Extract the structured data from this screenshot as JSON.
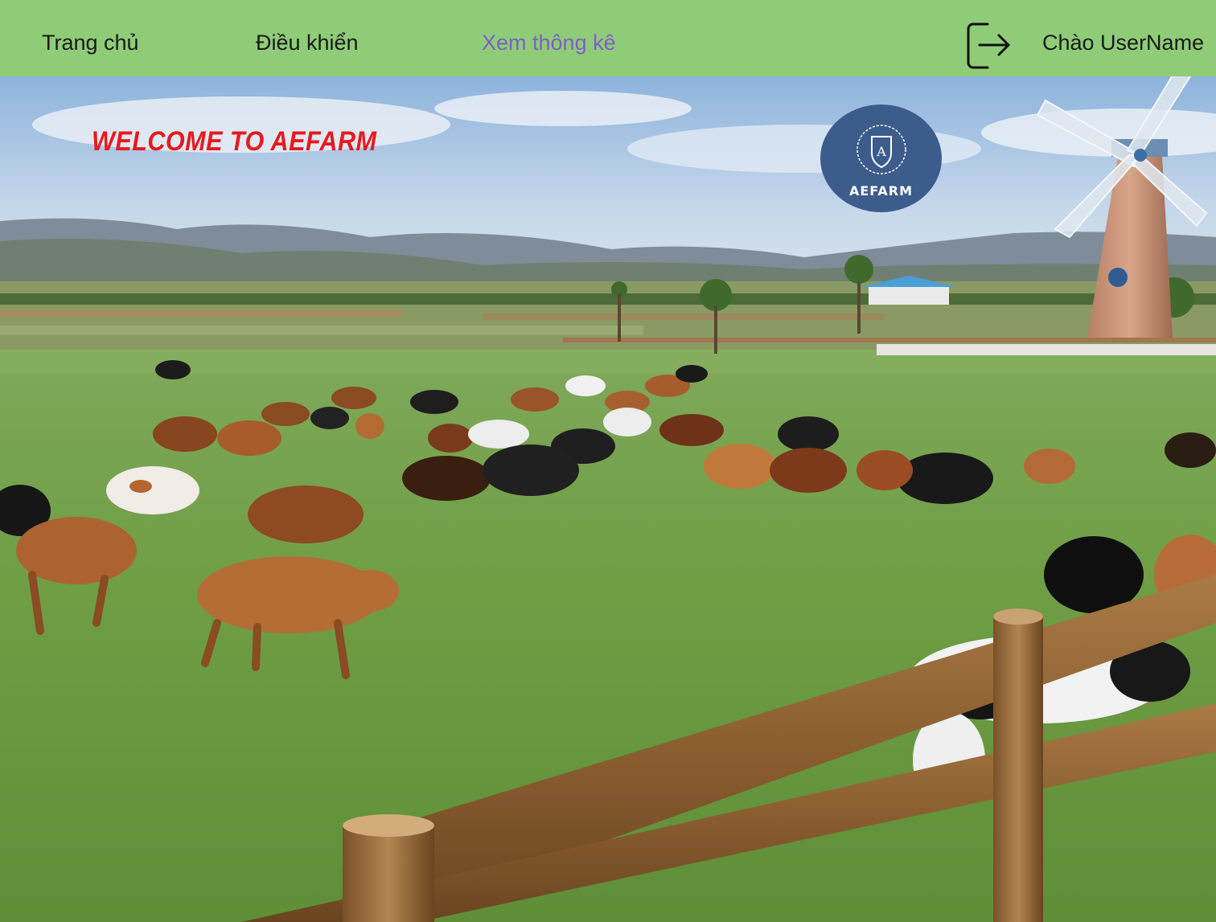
{
  "nav": {
    "home_label": "Trang chủ",
    "control_label": "Điều khiển",
    "stats_label": "Xem thông kê",
    "active_item": "stats",
    "logout_icon": "logout-icon",
    "greeting": "Chào UserName"
  },
  "hero": {
    "welcome_text": "WELCOME TO AEFARM",
    "logo_text": "AEFARM",
    "logo_letter": "A",
    "background": "farm pasture photo with grazing cows, windmill and wooden fence"
  },
  "colors": {
    "navbar_bg": "#8fcc78",
    "active_link": "#7e5fc7",
    "welcome_text": "#e8191e",
    "logo_bg": "#3c5c8c"
  }
}
